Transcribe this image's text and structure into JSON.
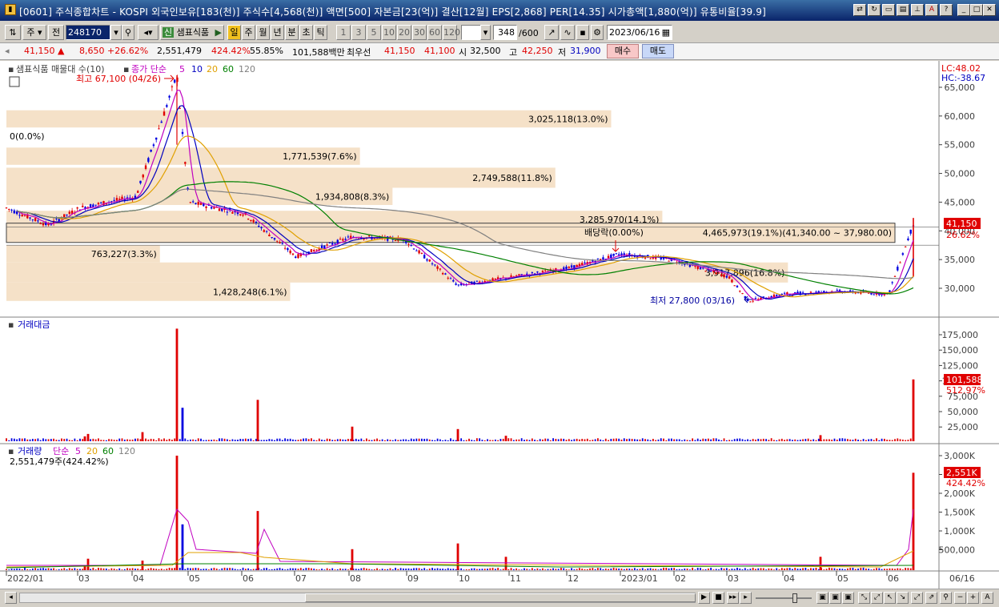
{
  "window": {
    "title": "[0601] 주식종합차트 - KOSPI 외국인보유[183(천)] 주식수[4,568(천)] 액면[500] 자본금[23(억)] 결산[12월] EPS[2,868] PER[14.35] 시가총액[1,880(억)] 유통비율[39.9]"
  },
  "toolbar": {
    "period_unit": "주",
    "prev_label": "전",
    "stock_code": "248170",
    "stock_name": "샘표식품",
    "stock_tag": "신",
    "tabs": [
      "일",
      "주",
      "월",
      "년",
      "분",
      "초",
      "틱"
    ],
    "active_tab": "일",
    "intervals": [
      "1",
      "3",
      "5",
      "10",
      "20",
      "30",
      "60",
      "120"
    ],
    "count_value": "348",
    "count_total": "/600",
    "date_value": "2023/06/16"
  },
  "quote": {
    "price": "41,150",
    "change": "8,650",
    "change_pct": "+26.62%",
    "volume": "2,551,479",
    "volume_ratio": "424.42%",
    "turnover": "55.85%",
    "amount": "101,588백만",
    "priority_label": "최우선",
    "ask": "41,150",
    "bid": "41,100",
    "open_label": "시",
    "open": "32,500",
    "high_label": "고",
    "high": "42,250",
    "low_label": "저",
    "low": "31,900",
    "buy_label": "매수",
    "sell_label": "매도"
  },
  "panes": {
    "price": {
      "legend_name": "샘표식품 매물대 수(10)",
      "legend_ma_label": "종가 단순",
      "legend_periods": [
        "5",
        "10",
        "20",
        "60",
        "120"
      ],
      "lc": "LC:48.02",
      "hc": "HC:-38.67",
      "high_note": "최고 67,100 (04/26)",
      "low_note": "최저 27,800 (03/16)",
      "dividend_note": "배당락(0.00%)",
      "last_price": "41,150",
      "last_pct": "26.62%",
      "yticks": [
        "65,000",
        "60,000",
        "55,000",
        "50,000",
        "45,000",
        "40,000",
        "35,000",
        "30,000"
      ]
    },
    "amount": {
      "legend_name": "거래대금",
      "last_value": "101,588",
      "last_pct": "512.97%",
      "yticks": [
        "175,000",
        "150,000",
        "125,000",
        "100,000",
        "75,000",
        "50,000",
        "25,000"
      ]
    },
    "volume": {
      "legend_name": "거래량",
      "legend_ma_label": "단순",
      "legend_periods": [
        "5",
        "20",
        "60",
        "120"
      ],
      "sub_label": "2,551,479주(424.42%)",
      "last_value": "2,551K",
      "last_pct": "424.42%",
      "yticks": [
        "3,000K",
        "2,500K",
        "2,000K",
        "1,500K",
        "1,000K",
        "500,000"
      ]
    }
  },
  "volume_profile": [
    {
      "label": "3,025,118(13.0%)",
      "low": 58000,
      "high": 61000,
      "share": 13.0
    },
    {
      "label": "0(0.0%)",
      "low": 55000,
      "high": 58000,
      "share": 0.0
    },
    {
      "label": "1,771,539(7.6%)",
      "low": 51500,
      "high": 54500,
      "share": 7.6
    },
    {
      "label": "2,749,588(11.8%)",
      "low": 47500,
      "high": 51000,
      "share": 11.8
    },
    {
      "label": "1,934,808(8.3%)",
      "low": 44500,
      "high": 47500,
      "share": 8.3
    },
    {
      "label": "3,285,970(14.1%)",
      "low": 40500,
      "high": 43500,
      "share": 14.1
    },
    {
      "label": "4,465,973(19.1%)(41,340.00 ~ 37,980.00)",
      "low": 37980,
      "high": 41340,
      "share": 19.1
    },
    {
      "label": "763,227(3.3%)",
      "low": 34500,
      "high": 37500,
      "share": 3.3
    },
    {
      "label": "3,917,896(16.8%)",
      "low": 31000,
      "high": 34500,
      "share": 16.8
    },
    {
      "label": "1,428,248(6.1%)",
      "low": 27800,
      "high": 31000,
      "share": 6.1
    }
  ],
  "x_axis": [
    "2022/01",
    "03",
    "04",
    "05",
    "06",
    "07",
    "08",
    "09",
    "10",
    "11",
    "12",
    "2023/01",
    "02",
    "03",
    "04",
    "05",
    "06",
    "06/16"
  ],
  "chart_data": [
    {
      "type": "line",
      "title": "",
      "series_name": "샘표식품",
      "x": [
        "2022/01",
        "2022/02",
        "2022/03",
        "2022/04",
        "2022/04/26",
        "2022/05",
        "2022/06",
        "2022/07",
        "2022/08",
        "2022/09",
        "2022/10",
        "2022/11",
        "2022/12",
        "2023/01",
        "2023/02",
        "2023/03",
        "2023/03/16",
        "2023/04",
        "2023/05",
        "2023/06",
        "2023/06/16"
      ],
      "y": [
        44000,
        41000,
        44000,
        46000,
        67100,
        45000,
        43000,
        35500,
        39000,
        38500,
        30500,
        32000,
        33500,
        36000,
        35000,
        32000,
        27800,
        29000,
        29500,
        29000,
        41150
      ],
      "ylim": [
        26000,
        68000
      ],
      "yunit": "원"
    },
    {
      "type": "bar",
      "title": "",
      "series_name": "거래대금",
      "x": [
        "2022/01",
        "2022/03",
        "2022/04",
        "2022/04/26",
        "2022/05",
        "2022/06",
        "2022/08",
        "2022/10",
        "2022/11",
        "2023/05",
        "2023/06/16"
      ],
      "y": [
        8000,
        12000,
        15000,
        185000,
        55000,
        68000,
        24000,
        20000,
        9000,
        10000,
        101588
      ],
      "ylim": [
        0,
        190000
      ]
    },
    {
      "type": "bar",
      "title": "",
      "series_name": "거래량",
      "x": [
        "2022/01",
        "2022/03",
        "2022/04",
        "2022/04/26",
        "2022/05",
        "2022/06",
        "2022/08",
        "2022/10",
        "2022/11",
        "2023/05",
        "2023/06/16"
      ],
      "y": [
        120000,
        300000,
        250000,
        3000000,
        1200000,
        1550000,
        550000,
        700000,
        350000,
        350000,
        2551479
      ],
      "ylim": [
        0,
        3200000
      ]
    }
  ]
}
